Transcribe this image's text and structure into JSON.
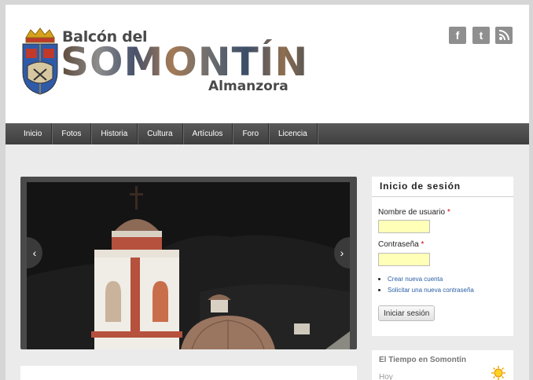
{
  "header": {
    "logo_top": "Balcón del",
    "logo_big": "SOMONTÍN",
    "logo_bottom": "Almanzora",
    "social": [
      "facebook-icon",
      "twitter-icon",
      "rss-icon"
    ]
  },
  "nav": {
    "items": [
      "Inicio",
      "Fotos",
      "Historia",
      "Cultura",
      "Artículos",
      "Foro",
      "Licencia"
    ]
  },
  "slider": {
    "prev": "‹",
    "next": "›"
  },
  "login": {
    "title": "Inicio de sesión",
    "username_label": "Nombre de usuario",
    "password_label": "Contraseña",
    "required_mark": "*",
    "username_value": "",
    "password_value": "",
    "links": [
      "Crear nueva cuenta",
      "Solicitar una nueva contraseña"
    ],
    "submit": "Iniciar sesión"
  },
  "weather": {
    "title": "El Tiempo en Somontín",
    "day": "Hoy"
  },
  "colors": {
    "nav_bg": "#4a4a4a",
    "input_bg": "#ffffb8",
    "link": "#2b5fa6",
    "required": "#cc0000"
  }
}
